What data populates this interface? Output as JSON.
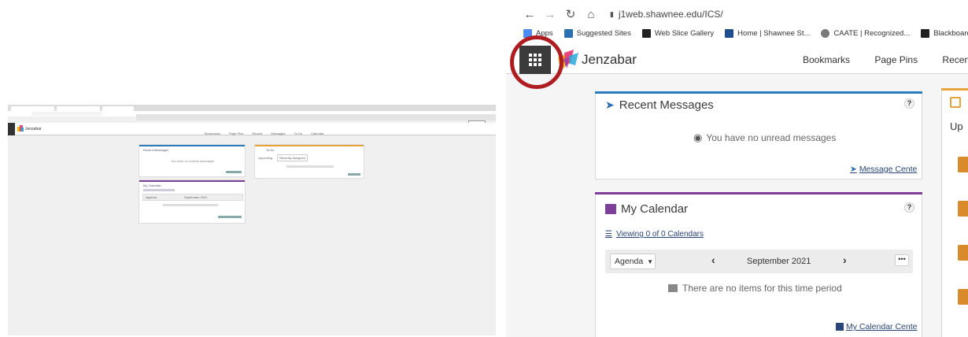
{
  "thumbnail": {
    "tabs": [
      "",
      "",
      ""
    ],
    "url_text": "",
    "brand": "Jenzabar",
    "nav_links": [
      "Bookmarks",
      "Page Pins",
      "Recent",
      "Messages",
      "To Do",
      "Calendar"
    ],
    "recent_messages_title": "Recent Messages",
    "recent_messages_empty": "You have no unread messages",
    "todo_title": "To Do",
    "todo_tab_upcoming": "Upcoming",
    "todo_tab_recent": "Recently Assigned",
    "calendar_title": "My Calendar",
    "calendar_select": "Agenda",
    "calendar_month": "September 2021",
    "footer": ""
  },
  "browser": {
    "url": "j1web.shawnee.edu/ICS/",
    "bookmarks": [
      {
        "label": "Apps",
        "color": "#4c8bf5"
      },
      {
        "label": "Suggested Sites",
        "color": "#2a6fb0"
      },
      {
        "label": "Web Slice Gallery",
        "color": "#222222"
      },
      {
        "label": "Home | Shawnee St...",
        "color": "#1e4e8c"
      },
      {
        "label": "CAATE | Recognized...",
        "color": "#7a7a7a"
      },
      {
        "label": "Blackboard Learn",
        "color": "#222222"
      }
    ]
  },
  "header": {
    "brand": "Jenzabar",
    "links": [
      "Bookmarks",
      "Page Pins",
      "Recent"
    ]
  },
  "recent_messages": {
    "title": "Recent Messages",
    "help": "?",
    "empty_text": "You have no unread messages",
    "link": "Message Cente"
  },
  "calendar": {
    "title": "My Calendar",
    "help": "?",
    "viewing": "Viewing 0 of 0 Calendars",
    "select": "Agenda",
    "month": "September 2021",
    "more": "•••",
    "empty_text": "There are no items for this time period",
    "link": "My Calendar Cente"
  },
  "side_card": {
    "title": "Up"
  },
  "colors": {
    "highlight_ring": "#b01c20",
    "messages_bar": "#2b7bbf",
    "calendar_bar": "#7d3f98",
    "todo_bar": "#e8a23c",
    "link": "#29457a"
  }
}
